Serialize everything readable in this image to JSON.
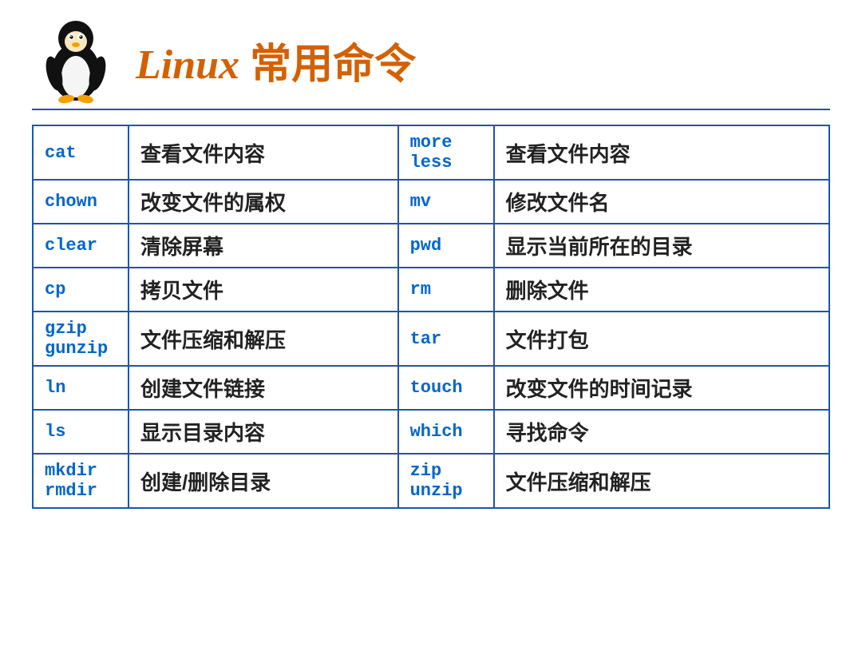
{
  "header": {
    "title_en": "Linux",
    "title_cn": "常用命令"
  },
  "rows": [
    {
      "cmd1": "cat",
      "desc1": "查看文件内容",
      "cmd2": "more\nless",
      "desc2": "查看文件内容"
    },
    {
      "cmd1": "chown",
      "desc1": "改变文件的属权",
      "cmd2": "mv",
      "desc2": "修改文件名"
    },
    {
      "cmd1": "clear",
      "desc1": "清除屏幕",
      "cmd2": "pwd",
      "desc2": "显示当前所在的目录"
    },
    {
      "cmd1": "cp",
      "desc1": "拷贝文件",
      "cmd2": "rm",
      "desc2": "删除文件"
    },
    {
      "cmd1": "gzip\ngunzip",
      "desc1": "文件压缩和解压",
      "cmd2": "tar",
      "desc2": "文件打包"
    },
    {
      "cmd1": "ln",
      "desc1": "创建文件链接",
      "cmd2": "touch",
      "desc2": "改变文件的时间记录"
    },
    {
      "cmd1": "ls",
      "desc1": "显示目录内容",
      "cmd2": "which",
      "desc2": "寻找命令"
    },
    {
      "cmd1": "mkdir\nrmdir",
      "desc1": "创建/删除目录",
      "cmd2": "zip\nunzip",
      "desc2": "文件压缩和解压"
    }
  ]
}
